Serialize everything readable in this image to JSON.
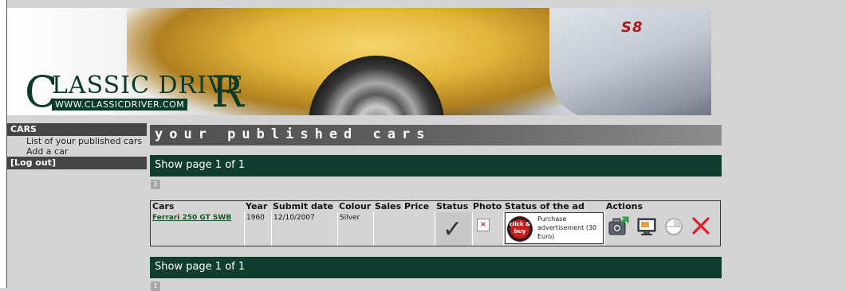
{
  "brand": {
    "logo_top": "LASSIC DRIVE",
    "logo_c": "C",
    "logo_r": "R",
    "logo_url": "WWW.CLASSICDRIVER.COM",
    "banner_plate": "S8"
  },
  "sidebar": {
    "section": "CARS",
    "items": [
      {
        "label": "List of your published cars"
      },
      {
        "label": "Add a car"
      }
    ],
    "logout": "[Log out]"
  },
  "main": {
    "title": "your published cars",
    "pager_top": "Show page 1 of 1",
    "pager_bottom": "Show page 1 of 1",
    "page_number": "1"
  },
  "table": {
    "headers": [
      "Cars",
      "Year",
      "Submit date",
      "Colour",
      "Sales Price",
      "Status",
      "Photo",
      "Status of the ad",
      "Actions"
    ],
    "rows": [
      {
        "car": "Ferrari 250 GT SWB",
        "year": "1960",
        "submit_date": "12/10/2007",
        "colour": "Silver",
        "sales_price": "",
        "status_icon": "check-icon",
        "photo_icon": "broken-image-icon",
        "ad_badge": "click & buy",
        "ad_status": "Purchase advertisement (30 Euro)",
        "actions": [
          "camera-icon",
          "screen-icon",
          "toggle-icon",
          "delete-icon"
        ]
      }
    ]
  },
  "colors": {
    "bar_green": "#0f3d2f",
    "link_green": "#0f5a22",
    "delete_red": "#e02020",
    "page_bg": "#d4d4d4"
  }
}
